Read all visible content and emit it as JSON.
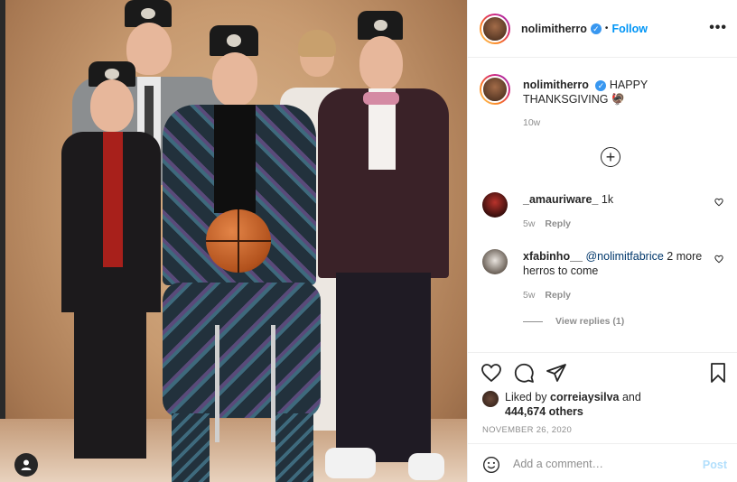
{
  "post": {
    "username": "nolimitherro",
    "verified_icon": "verified-badge-icon",
    "dot": "•",
    "follow_label": "Follow",
    "more_icon": "more-options-icon",
    "more_label": "•••"
  },
  "caption": {
    "username": "nolimitherro",
    "text": "HAPPY THANKSGIVING 🦃",
    "time": "10w"
  },
  "load_more_icon": "plus-circle-icon",
  "load_more_label": "+",
  "comments": [
    {
      "username": "_amauriware_",
      "text": "1k",
      "mention": "",
      "age": "5w",
      "reply_label": "Reply"
    },
    {
      "username": "xfabinho__",
      "mention": "@nolimitfabrice",
      "text": "2 more herros to come",
      "age": "5w",
      "reply_label": "Reply"
    }
  ],
  "view_replies": "View replies (1)",
  "likes": {
    "prefix": "Liked by",
    "user": "correiaysilva",
    "and": "and",
    "count": "444,674 others"
  },
  "date": "NOVEMBER 26, 2020",
  "add_comment": {
    "placeholder": "Add a comment…",
    "post_label": "Post"
  },
  "colors": {
    "link_blue": "#0095f6",
    "post_disabled": "#b2dffc",
    "meta_gray": "#8e8e8e"
  }
}
